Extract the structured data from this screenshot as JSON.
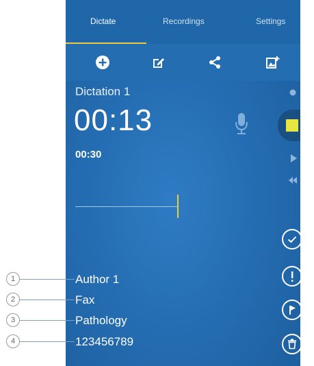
{
  "tabs": [
    {
      "label": "Dictate",
      "active": true
    },
    {
      "label": "Recordings",
      "active": false
    },
    {
      "label": "Settings",
      "active": false
    }
  ],
  "toolbar": {
    "icons": [
      "add-icon",
      "edit-icon",
      "share-icon",
      "image-add-icon"
    ]
  },
  "dictation": {
    "title": "Dictation 1",
    "elapsed": "00:13",
    "total": "00:30"
  },
  "controls": [
    "record-icon",
    "stop-icon",
    "play-icon",
    "rewind-icon"
  ],
  "status_buttons": [
    "checkmark-icon",
    "priority-icon",
    "flag-icon",
    "delete-icon"
  ],
  "info": {
    "author": "Author 1",
    "worktype": "Fax",
    "category": "Pathology",
    "number": "123456789"
  },
  "callouts": [
    "1",
    "2",
    "3",
    "4"
  ],
  "colors": {
    "background": "#256db2",
    "tab_bar": "#1f67a8",
    "accent_yellow": "#e7e53f",
    "tab_underline": "#f0c93b"
  }
}
